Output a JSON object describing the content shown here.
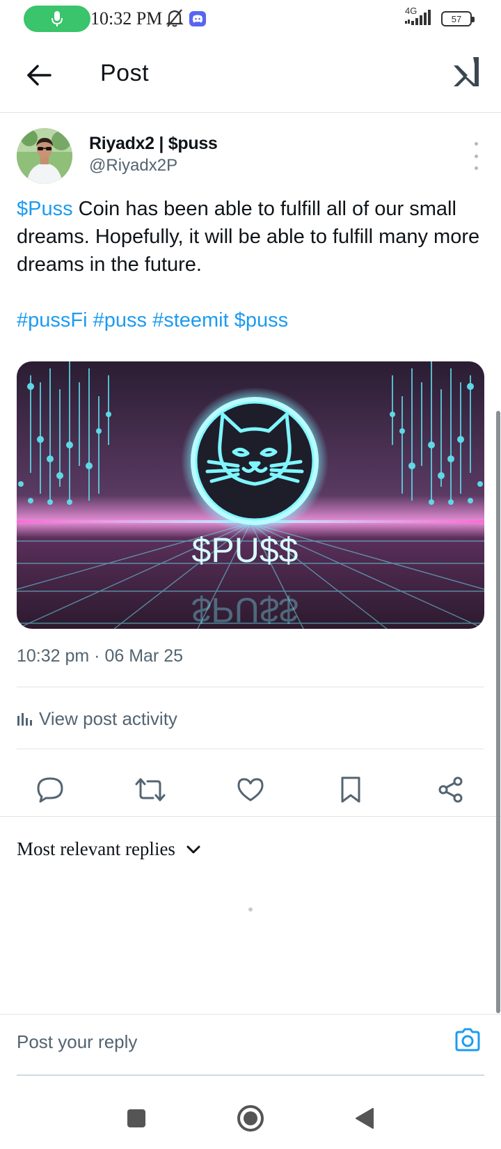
{
  "status_bar": {
    "time": "10:32 PM",
    "network": "4G",
    "battery": "57",
    "icons": [
      "mic-icon",
      "mute-icon",
      "discord-icon",
      "signal-icon",
      "battery-icon"
    ],
    "mic_color": "#3ac46b"
  },
  "header": {
    "title": "Post",
    "back_icon": "arrow-left-icon",
    "logo_icon": "grok-logo-icon"
  },
  "post": {
    "display_name": "Riyadx2 | $puss",
    "handle": "@Riyadx2P",
    "cashtag": "$Puss",
    "text": " Coin has been able to fulfill all of our small dreams. Hopefully, it will be able to fulfill many more dreams in the future.",
    "tags": [
      "#pussFi",
      "#puss",
      "#steemit",
      "$puss"
    ],
    "media_text": "$PU$$",
    "timestamp": "10:32 pm · 06 Mar 25",
    "activity_label": "View post activity",
    "link_color": "#1d9bf0"
  },
  "actions": [
    {
      "name": "reply",
      "icon": "comment-icon"
    },
    {
      "name": "repost",
      "icon": "repost-icon"
    },
    {
      "name": "like",
      "icon": "heart-icon"
    },
    {
      "name": "bookmark",
      "icon": "bookmark-icon"
    },
    {
      "name": "share",
      "icon": "share-icon"
    }
  ],
  "replies": {
    "filter_label": "Most relevant replies"
  },
  "reply_bar": {
    "placeholder": "Post your reply",
    "camera_color": "#1d9bf0"
  },
  "nav_bar": {
    "buttons": [
      "recents-button",
      "home-button",
      "back-button"
    ]
  }
}
